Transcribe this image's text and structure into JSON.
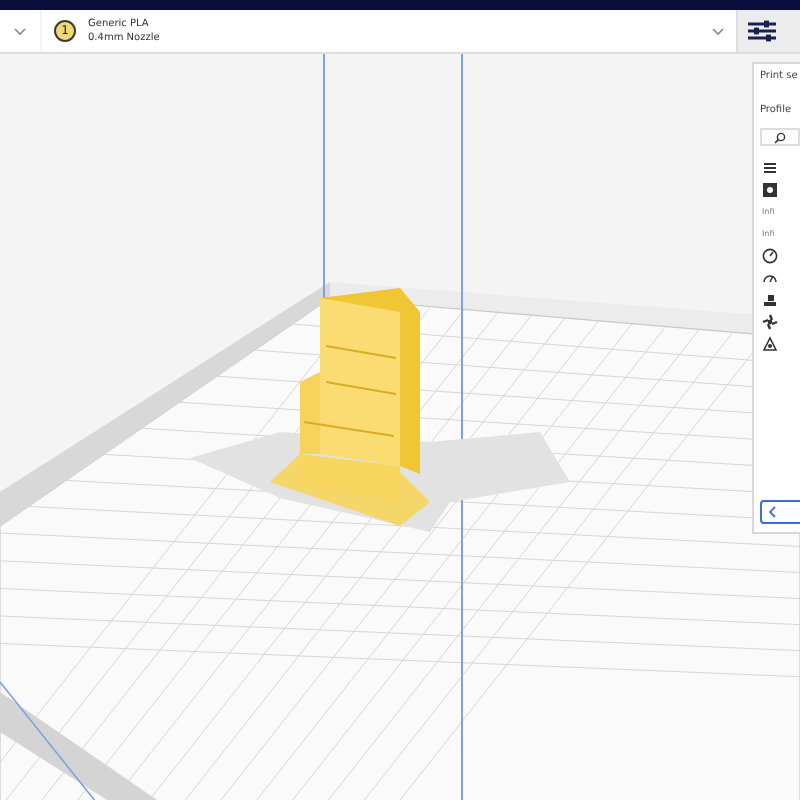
{
  "header": {
    "extruder_number": "1",
    "material": "Generic PLA",
    "nozzle": "0.4mm Nozzle"
  },
  "side_panel": {
    "title": "Print se",
    "profile_label": "Profile",
    "rows": [
      {
        "kind": "icon"
      },
      {
        "kind": "icon"
      },
      {
        "kind": "text",
        "label": "Infi"
      },
      {
        "kind": "text",
        "label": "Infi"
      },
      {
        "kind": "icon"
      },
      {
        "kind": "icon"
      },
      {
        "kind": "icon"
      },
      {
        "kind": "icon"
      },
      {
        "kind": "icon"
      }
    ]
  }
}
